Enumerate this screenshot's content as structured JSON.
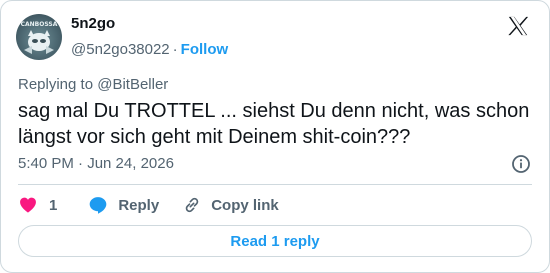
{
  "author": {
    "display_name": "5n2go",
    "handle": "@5n2go38022",
    "follow_label": "Follow",
    "avatar_badge": "CANBOSSA"
  },
  "tweet": {
    "replying_prefix": "Replying to ",
    "replying_to": "@BitBeller",
    "text": "sag mal Du TROTTEL ... siehst Du denn nicht, was schon längst vor sich geht mit Deinem shit-coin???",
    "timestamp": "5:40 PM · Jun 24, 2026"
  },
  "actions": {
    "like_count": "1",
    "reply_label": "Reply",
    "copy_link_label": "Copy link"
  },
  "footer": {
    "read_replies_label": "Read 1 reply"
  },
  "icons": {
    "like": "heart-icon",
    "reply": "reply-bubble-icon",
    "copy": "link-icon",
    "info": "info-icon",
    "logo": "x-logo-icon"
  },
  "colors": {
    "accent": "#1d9bf0",
    "like": "#f91880",
    "text": "#0f1419",
    "muted": "#536471",
    "border": "#cfd9de"
  }
}
